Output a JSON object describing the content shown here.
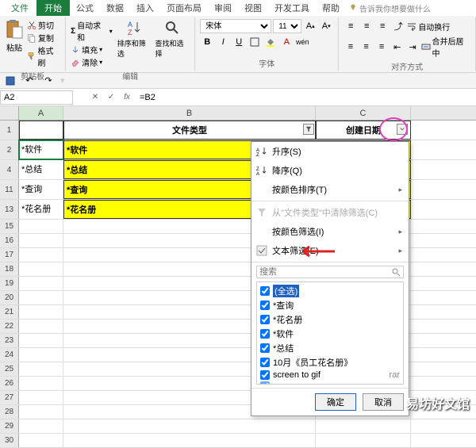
{
  "tabs": {
    "file": "文件",
    "home": "开始",
    "formulas": "公式",
    "data": "数据",
    "insert": "插入",
    "layout": "页面布局",
    "review": "审阅",
    "view": "视图",
    "developer": "开发工具",
    "help": "帮助",
    "tellme": "告诉我你想要做什么"
  },
  "ribbon": {
    "paste": "粘贴",
    "cut": "剪切",
    "copy": "复制",
    "format_painter": "格式刷",
    "clipboard_label": "剪贴板",
    "autosum": "自动求和",
    "fill": "填充",
    "clear": "清除",
    "sort_filter": "排序和筛选",
    "find_select": "查找和选择",
    "editing_label": "编辑",
    "font_name": "宋体",
    "font_size": "11",
    "font_label": "字体",
    "wrap": "自动换行",
    "merge": "合并后居中",
    "align_label": "对齐方式"
  },
  "namebox": "A2",
  "formula": "=B2",
  "columns": {
    "A": "A",
    "B": "B",
    "C": "C"
  },
  "headers": {
    "filetype": "文件类型",
    "createdate": "创建日期"
  },
  "rows": [
    {
      "n": "1"
    },
    {
      "n": "2",
      "a": "*软件",
      "b": "*软件"
    },
    {
      "n": "4",
      "a": "*总结",
      "b": "*总结"
    },
    {
      "n": "11",
      "a": "*查询",
      "b": "*查询"
    },
    {
      "n": "13",
      "a": "*花名册",
      "b": "*花名册"
    }
  ],
  "empty_rows": [
    "15",
    "16",
    "17",
    "18",
    "19",
    "20",
    "21",
    "22",
    "23",
    "24",
    "25",
    "26",
    "27",
    "28",
    "29",
    "30"
  ],
  "filter": {
    "asc": "升序(S)",
    "desc": "降序(Q)",
    "bycolor_sort": "按颜色排序(T)",
    "clear": "从\"文件类型\"中清除筛选(C)",
    "bycolor_filter": "按颜色筛选(I)",
    "text_filter": "文本筛选(E)",
    "search_placeholder": "搜索",
    "select_all": "(全选)",
    "items": [
      "*查询",
      "*花名册",
      "*软件",
      "*总结",
      "10月《员工花名册》",
      "screen to gif"
    ],
    "ext_rar": "rar",
    "ok": "确定",
    "cancel": "取消"
  },
  "watermark": "易坊好文馆"
}
